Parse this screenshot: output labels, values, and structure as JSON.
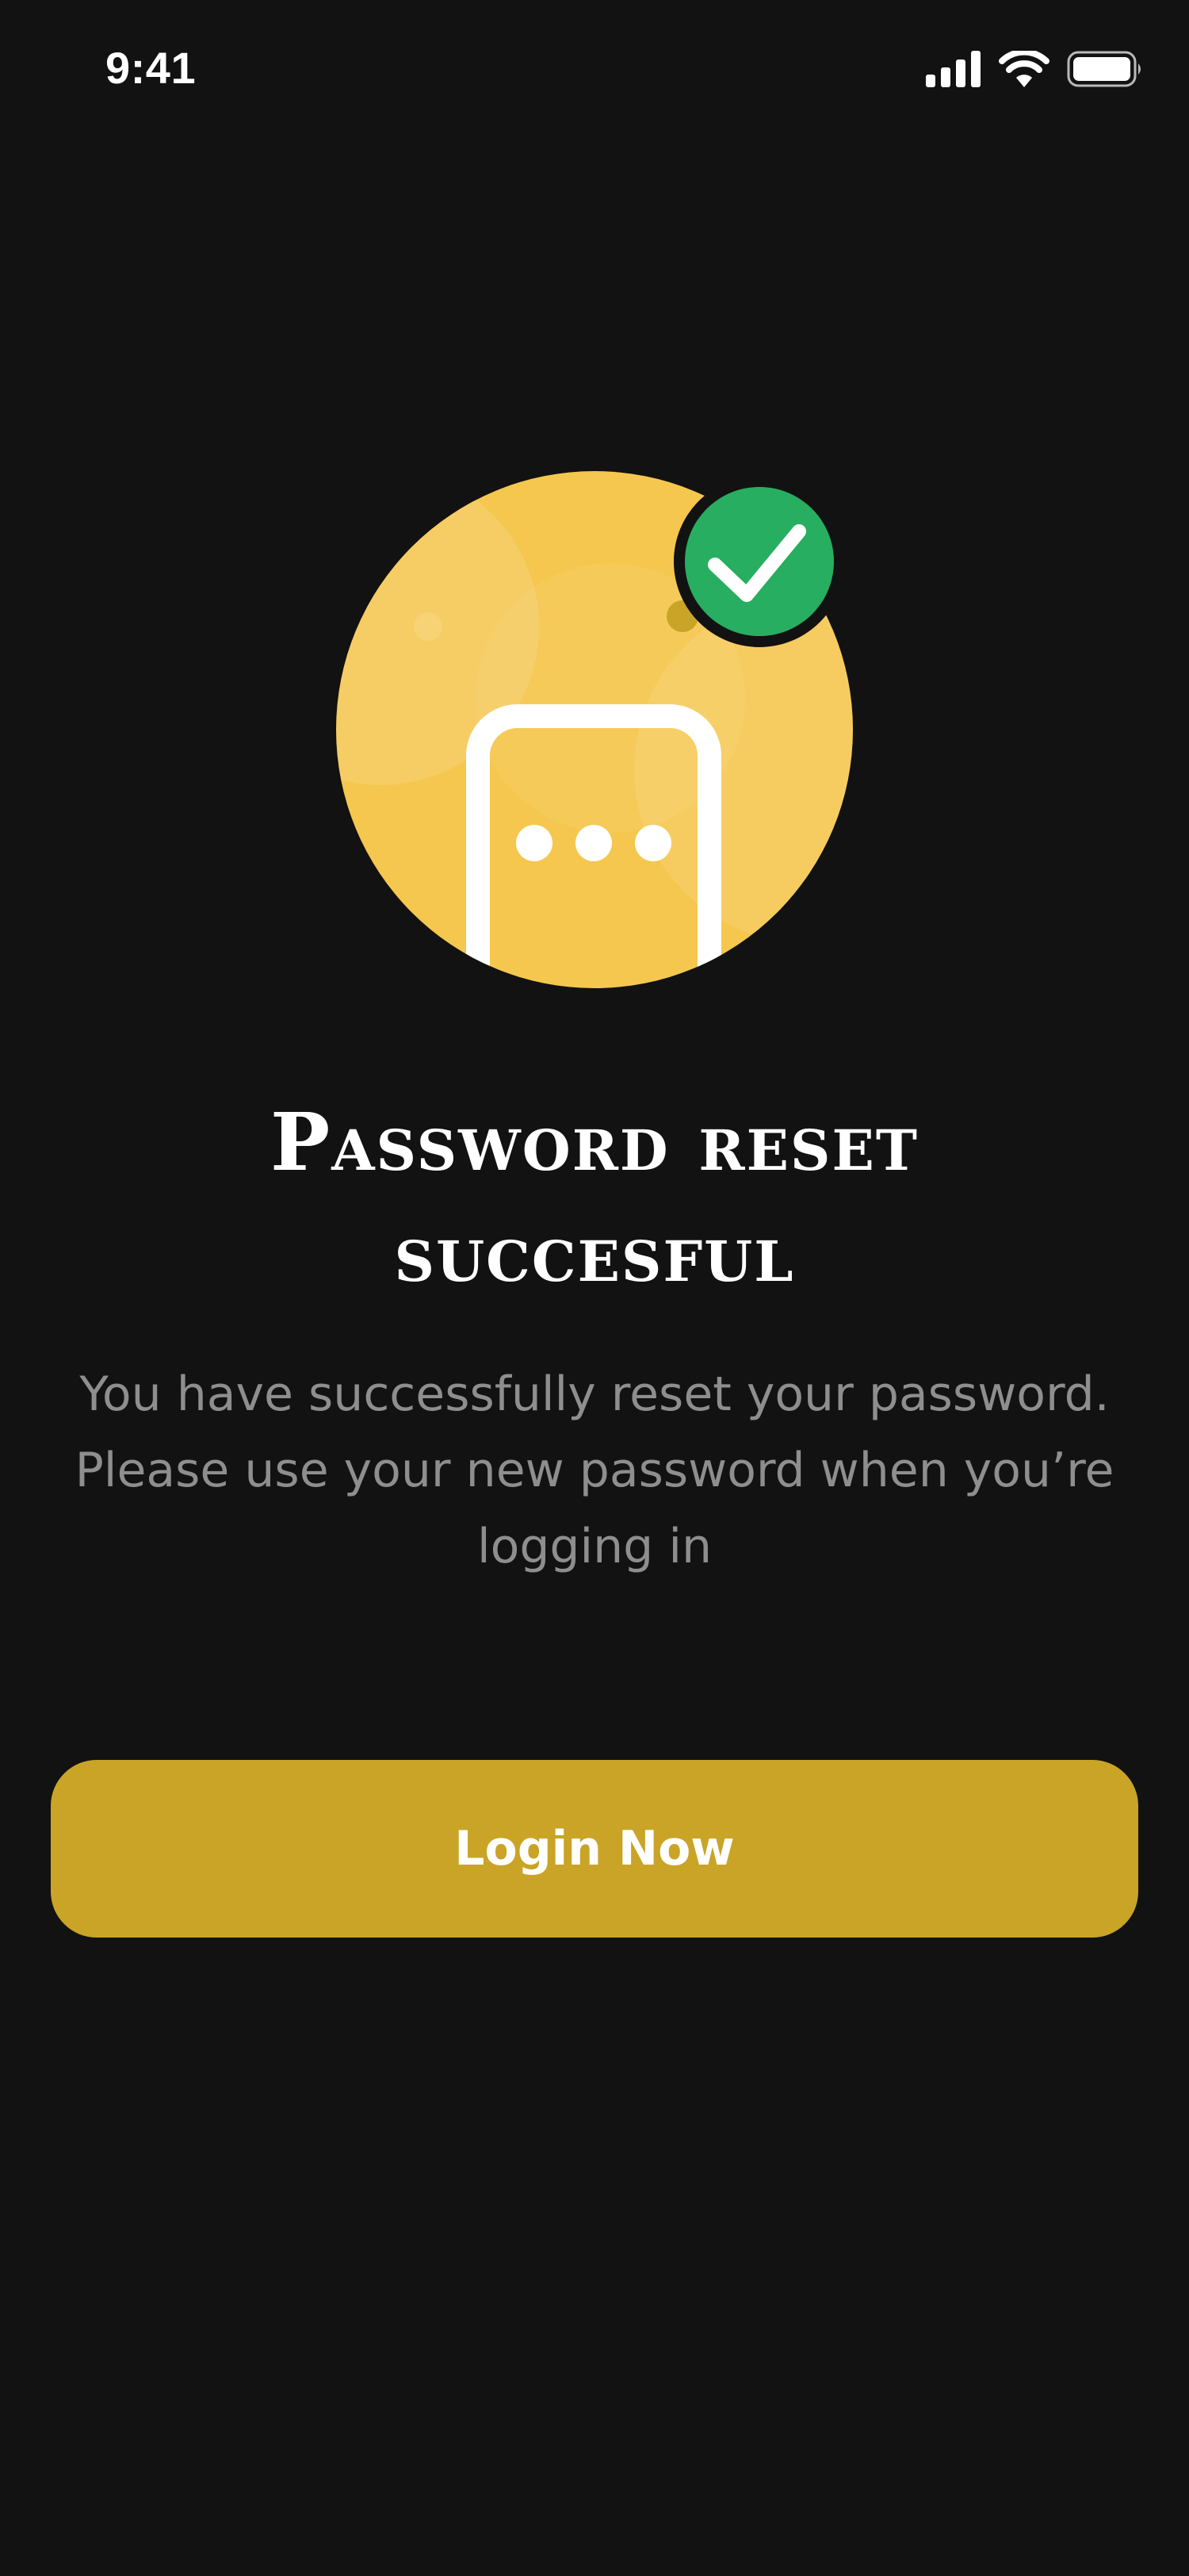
{
  "status_bar": {
    "time": "9:41",
    "icons": [
      "signal-icon",
      "wifi-icon",
      "battery-icon"
    ]
  },
  "illustration": {
    "icon": "phone-password-icon",
    "badge_icon": "check-icon",
    "colors": {
      "circle": "#f5c74f",
      "badge": "#27ae60",
      "phone_outline": "#ffffff"
    }
  },
  "content": {
    "title_line1": "Password reset",
    "title_line2": "succesful",
    "message_line1": "You have successfully reset your password.",
    "message_line2": "Please use your new password when you’re",
    "message_line3": "logging in"
  },
  "actions": {
    "login_label": "Login Now"
  },
  "theme": {
    "background": "#121212",
    "accent": "#c9a427",
    "muted_text": "#8e8e8e"
  }
}
